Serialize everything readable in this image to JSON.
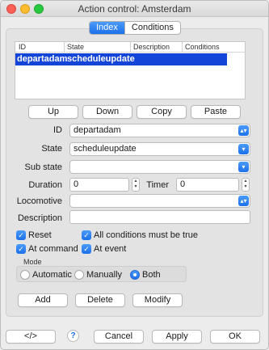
{
  "window": {
    "title": "Action control: Amsterdam"
  },
  "tabs": [
    {
      "label": "Index",
      "active": true
    },
    {
      "label": "Conditions",
      "active": false
    }
  ],
  "table": {
    "columns": [
      "ID",
      "State",
      "Description",
      "Conditions"
    ],
    "rows": [
      {
        "id": "departadam",
        "state": "scheduleupdate",
        "description": "",
        "conditions": ""
      }
    ]
  },
  "list_buttons": {
    "up": "Up",
    "down": "Down",
    "copy": "Copy",
    "paste": "Paste"
  },
  "form": {
    "id_label": "ID",
    "id_value": "departadam",
    "state_label": "State",
    "state_value": "scheduleupdate",
    "substate_label": "Sub state",
    "substate_value": "",
    "duration_label": "Duration",
    "duration_value": "0",
    "timer_label": "Timer",
    "timer_value": "0",
    "locomotive_label": "Locomotive",
    "locomotive_value": "",
    "description_label": "Description",
    "description_value": ""
  },
  "checks": {
    "reset": {
      "label": "Reset",
      "checked": true
    },
    "all_conditions": {
      "label": "All conditions must be true",
      "checked": true
    },
    "at_command": {
      "label": "At command",
      "checked": true
    },
    "at_event": {
      "label": "At event",
      "checked": true
    }
  },
  "mode": {
    "title": "Mode",
    "options": [
      {
        "label": "Automatic",
        "selected": false
      },
      {
        "label": "Manually",
        "selected": false
      },
      {
        "label": "Both",
        "selected": true
      }
    ]
  },
  "action_buttons": {
    "add": "Add",
    "delete": "Delete",
    "modify": "Modify"
  },
  "footer": {
    "xml": "</>",
    "help": "?",
    "cancel": "Cancel",
    "apply": "Apply",
    "ok": "OK"
  },
  "colors": {
    "accent": "#1c70ea",
    "selection": "#1346d8"
  }
}
